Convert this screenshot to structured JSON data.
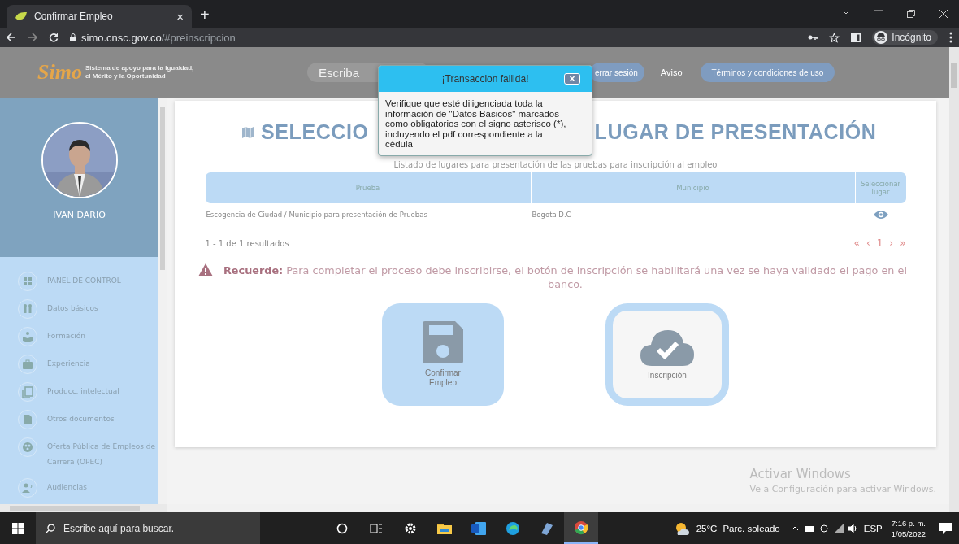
{
  "browser": {
    "tab_title": "Confirmar Empleo",
    "tab_close": "×",
    "new_tab": "+",
    "url_domain": "simo.cnsc.gov.co",
    "url_path": "/#preinscripcion",
    "profile": "Incógnito"
  },
  "header": {
    "logo_mark": "Simo",
    "logo_lines": [
      "Sistema de apoyo para la Igualdad,",
      "el Mérito y la Oportunidad"
    ],
    "search_placeholder": "Escriba",
    "logout": "errar sesión",
    "notice": "Aviso",
    "terms": "Términos y condiciones de uso"
  },
  "sidebar": {
    "user": "IVAN DARIO",
    "items": [
      {
        "label": "PANEL DE CONTROL"
      },
      {
        "label": "Datos básicos"
      },
      {
        "label": "Formación"
      },
      {
        "label": "Experiencia"
      },
      {
        "label": "Producc. intelectual"
      },
      {
        "label": "Otros documentos"
      },
      {
        "label": "Oferta Pública de Empleos de Carrera (OPEC)"
      },
      {
        "label": "Audiencias"
      }
    ]
  },
  "dialog": {
    "title": "¡Transaccion fallida!",
    "close": "×",
    "message": "Verifique que esté diligenciada toda la información de \"Datos Básicos\" marcados como obligatorios con el signo asterisco (*), incluyendo el pdf correspondiente a la cédula"
  },
  "main": {
    "title_parts": [
      "SELECCIO",
      "LUGAR DE PRESENTACIÓN"
    ],
    "subtitle": "Listado de lugares para presentación de las pruebas para inscripción al empleo",
    "table": {
      "columns": [
        "Prueba",
        "Municipio",
        "Seleccionar lugar"
      ],
      "rows": [
        [
          "Escogencia de Ciudad / Municipio para presentación de Pruebas",
          "Bogota D.C"
        ]
      ]
    },
    "results": "1 - 1 de 1 resultados",
    "pagination": [
      "«",
      "‹",
      "1",
      "›",
      "»"
    ],
    "notice": "**Recuerde:** Para completar el proceso debe inscribirse, el botón de inscripción se habilitará una vez se haya validado el pago en el banco.",
    "actions": [
      {
        "kind": "save",
        "label": "Confirmar Empleo"
      },
      {
        "kind": "upload",
        "label": "Inscripción"
      }
    ]
  },
  "windows_notice": {
    "title": "Activar Windows",
    "text": "Ve a Configuración para activar Windows."
  },
  "taskbar": {
    "search_placeholder": "Escribe aquí para buscar.",
    "temperature": "25°C",
    "weather": "Parc. soleado",
    "language": "ESP",
    "time": "7:16 p. m.",
    "date": "1/05/2022"
  }
}
